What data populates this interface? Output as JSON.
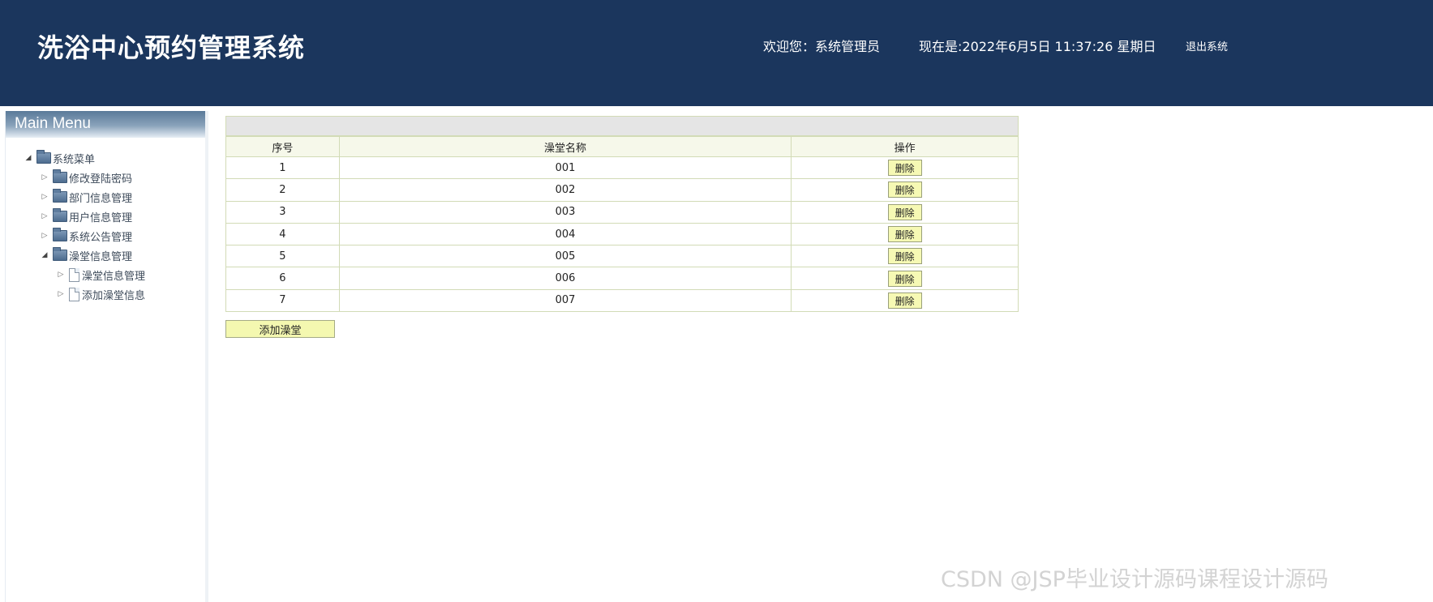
{
  "header": {
    "app_title": "洗浴中心预约管理系统",
    "welcome": "欢迎您：系统管理员",
    "datetime": "现在是:2022年6月5日 11:37:26 星期日",
    "logout": "退出系统"
  },
  "sidebar": {
    "title": "Main Menu",
    "root": "系统菜单",
    "items": [
      "修改登陆密码",
      "部门信息管理",
      "用户信息管理",
      "系统公告管理",
      "澡堂信息管理"
    ],
    "subitems": [
      "澡堂信息管理",
      "添加澡堂信息"
    ]
  },
  "table": {
    "headers": [
      "序号",
      "澡堂名称",
      "操作"
    ],
    "rows": [
      [
        "1",
        "001",
        "删除"
      ],
      [
        "2",
        "002",
        "删除"
      ],
      [
        "3",
        "003",
        "删除"
      ],
      [
        "4",
        "004",
        "删除"
      ],
      [
        "5",
        "005",
        "删除"
      ],
      [
        "6",
        "006",
        "删除"
      ],
      [
        "7",
        "007",
        "删除"
      ]
    ]
  },
  "actions": {
    "add_label": "添加澡堂"
  },
  "watermark": "CSDN @JSP毕业设计源码课程设计源码"
}
